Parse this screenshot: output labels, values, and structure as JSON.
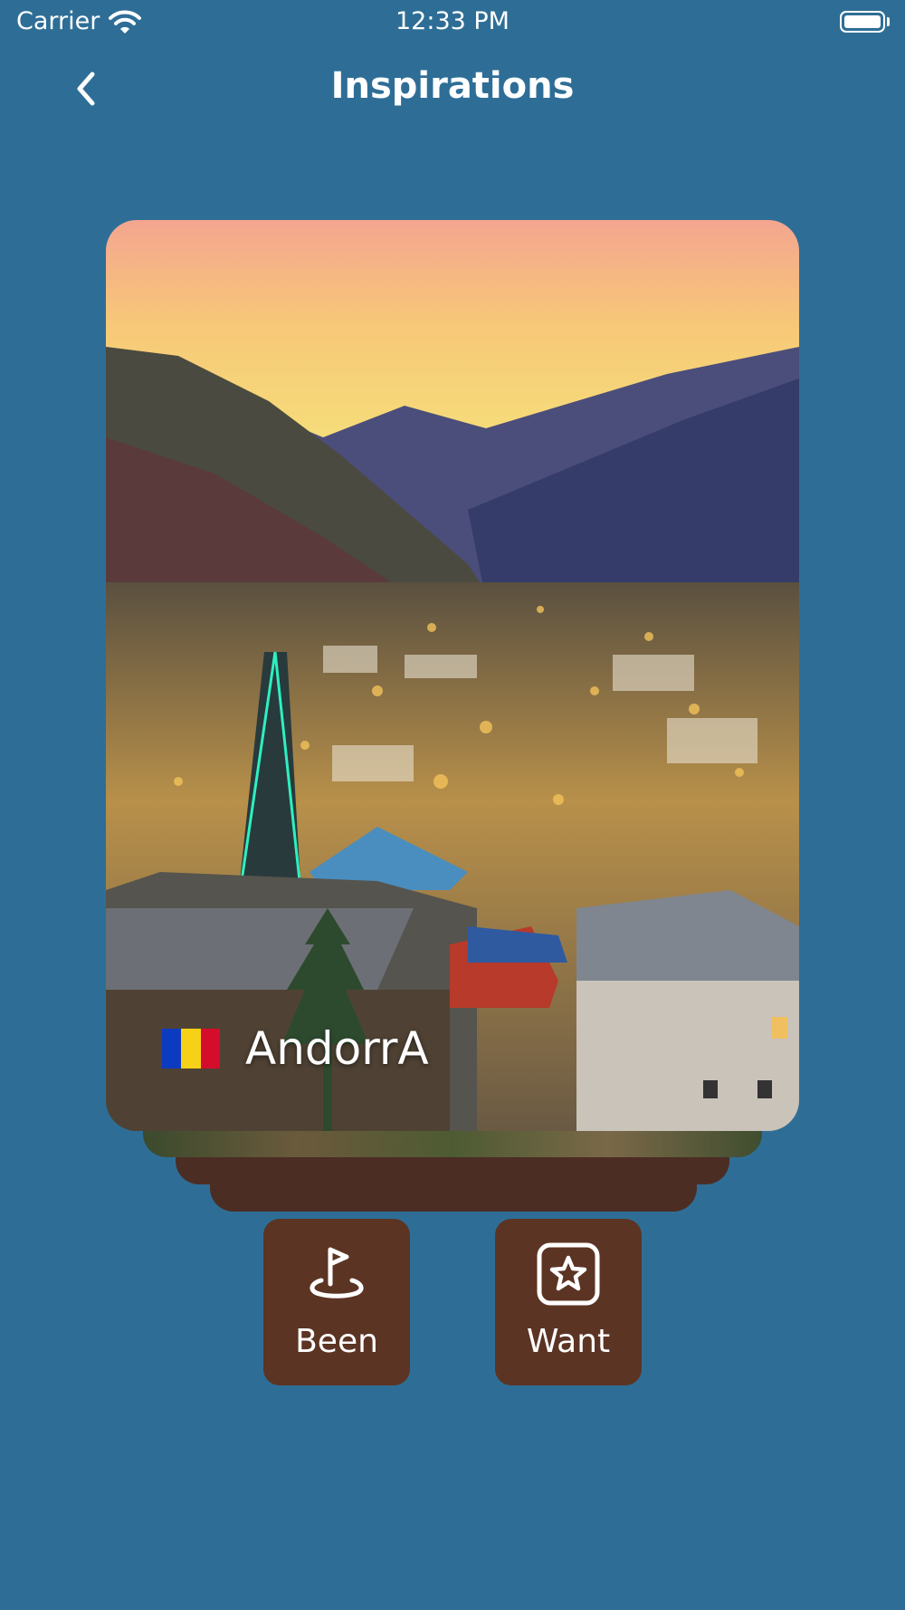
{
  "status_bar": {
    "carrier": "Carrier",
    "time": "12:33 PM",
    "icons": [
      "wifi-icon",
      "battery-icon"
    ]
  },
  "nav": {
    "title": "Inspirations",
    "back_icon": "chevron-left-icon"
  },
  "card": {
    "country": "AndorrA",
    "flag_colors": [
      "#0d3bbf",
      "#f7d117",
      "#d50d2d"
    ],
    "image": "night-city-valley-photo"
  },
  "actions": {
    "been": {
      "label": "Been",
      "icon": "flag-location-icon"
    },
    "want": {
      "label": "Want",
      "icon": "star-square-icon"
    }
  },
  "colors": {
    "background": "#2e6e96",
    "button": "#5c3424",
    "stack": "#4c2d24"
  }
}
